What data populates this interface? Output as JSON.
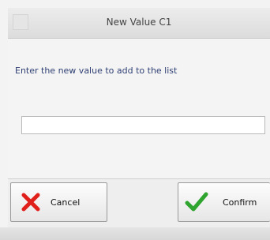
{
  "window": {
    "title": "New Value C1"
  },
  "form": {
    "prompt": "Enter the new value to add to the list",
    "value": "",
    "placeholder": ""
  },
  "buttons": {
    "cancel_label": "Cancel",
    "confirm_label": "Confirm"
  },
  "icons": {
    "cancel": "close-x-icon",
    "confirm": "checkmark-icon"
  },
  "colors": {
    "prompt_text": "#2f3f73",
    "cancel_icon": "#e0201a",
    "confirm_icon": "#2fa52f"
  }
}
